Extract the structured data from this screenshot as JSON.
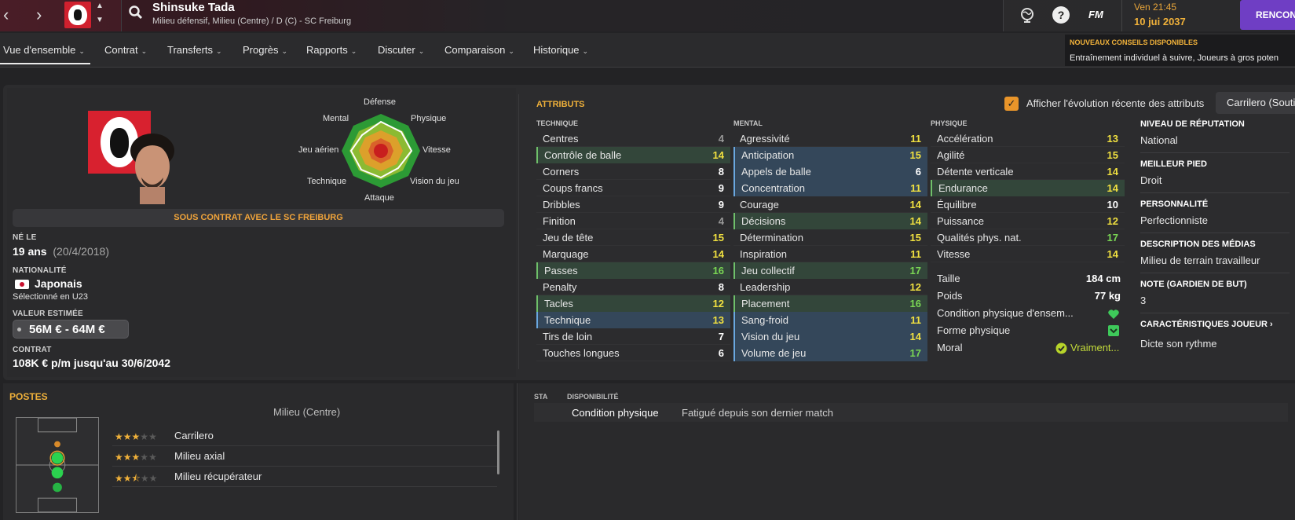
{
  "header": {
    "player_name": "Shinsuke Tada",
    "player_sub": "Milieu défensif, Milieu (Centre) / D (C) - SC Freiburg",
    "time": "Ven 21:45",
    "date": "10 jui 2037",
    "continue": "RENCON",
    "fm": "FM",
    "help": "?"
  },
  "nav": {
    "tabs": [
      "Vue d'ensemble",
      "Contrat",
      "Transferts",
      "Progrès",
      "Rapports",
      "Discuter",
      "Comparaison",
      "Historique"
    ]
  },
  "advice": {
    "title": "NOUVEAUX CONSEILS DISPONIBLES",
    "text": "Entraînement individuel à suivre, Joueurs à gros poten"
  },
  "radar": {
    "labels": [
      "Défense",
      "Physique",
      "Vitesse",
      "Vision du jeu",
      "Attaque",
      "Technique",
      "Jeu aérien",
      "Mental"
    ]
  },
  "profile": {
    "contract_banner": "SOUS CONTRAT AVEC LE SC FREIBURG",
    "born_label": "NÉ LE",
    "age": "19 ans",
    "birth": "(20/4/2018)",
    "nat_label": "NATIONALITÉ",
    "nationality": "Japonais",
    "selection": "Sélectionné en U23",
    "value_label": "VALEUR ESTIMÉE",
    "value": "56M € - 64M €",
    "contract_label": "CONTRAT",
    "contract": "108K € p/m jusqu'au 30/6/2042"
  },
  "attributes": {
    "title": "ATTRIBUTS",
    "evolution_label": "Afficher l'évolution récente des attributs",
    "role": "Carrilero (Soutien)",
    "technique_header": "TECHNIQUE",
    "mental_header": "MENTAL",
    "physique_header": "PHYSIQUE",
    "technique": [
      {
        "name": "Centres",
        "value": "4",
        "style": "plain",
        "color": "#9a9a9a"
      },
      {
        "name": "Contrôle de balle",
        "value": "14",
        "style": "green",
        "color": "#f0e040"
      },
      {
        "name": "Corners",
        "value": "8",
        "style": "plain",
        "color": "#ffffff"
      },
      {
        "name": "Coups francs",
        "value": "9",
        "style": "plain",
        "color": "#ffffff"
      },
      {
        "name": "Dribbles",
        "value": "9",
        "style": "plain",
        "color": "#ffffff"
      },
      {
        "name": "Finition",
        "value": "4",
        "style": "plain",
        "color": "#9a9a9a"
      },
      {
        "name": "Jeu de tête",
        "value": "15",
        "style": "plain",
        "color": "#f0e040"
      },
      {
        "name": "Marquage",
        "value": "14",
        "style": "plain",
        "color": "#f0e040"
      },
      {
        "name": "Passes",
        "value": "16",
        "style": "green",
        "color": "#7ad654"
      },
      {
        "name": "Penalty",
        "value": "8",
        "style": "plain",
        "color": "#ffffff"
      },
      {
        "name": "Tacles",
        "value": "12",
        "style": "green",
        "color": "#f0e040"
      },
      {
        "name": "Technique",
        "value": "13",
        "style": "blue",
        "color": "#f0e040"
      },
      {
        "name": "Tirs de loin",
        "value": "7",
        "style": "plain",
        "color": "#ffffff"
      },
      {
        "name": "Touches longues",
        "value": "6",
        "style": "plain",
        "color": "#ffffff"
      }
    ],
    "mental": [
      {
        "name": "Agressivité",
        "value": "11",
        "style": "plain",
        "color": "#f0e040"
      },
      {
        "name": "Anticipation",
        "value": "15",
        "style": "blue",
        "color": "#f0e040"
      },
      {
        "name": "Appels de balle",
        "value": "6",
        "style": "blue",
        "color": "#ffffff"
      },
      {
        "name": "Concentration",
        "value": "11",
        "style": "blue",
        "color": "#f0e040"
      },
      {
        "name": "Courage",
        "value": "14",
        "style": "plain",
        "color": "#f0e040"
      },
      {
        "name": "Décisions",
        "value": "14",
        "style": "green",
        "color": "#f0e040"
      },
      {
        "name": "Détermination",
        "value": "15",
        "style": "plain",
        "color": "#f0e040"
      },
      {
        "name": "Inspiration",
        "value": "11",
        "style": "plain",
        "color": "#f0e040"
      },
      {
        "name": "Jeu collectif",
        "value": "17",
        "style": "green",
        "color": "#7ad654"
      },
      {
        "name": "Leadership",
        "value": "12",
        "style": "plain",
        "color": "#f0e040"
      },
      {
        "name": "Placement",
        "value": "16",
        "style": "green",
        "color": "#7ad654"
      },
      {
        "name": "Sang-froid",
        "value": "11",
        "style": "blue",
        "color": "#f0e040"
      },
      {
        "name": "Vision du jeu",
        "value": "14",
        "style": "blue",
        "color": "#f0e040"
      },
      {
        "name": "Volume de jeu",
        "value": "17",
        "style": "blue",
        "color": "#7ad654"
      }
    ],
    "physique": [
      {
        "name": "Accélération",
        "value": "13",
        "style": "plain",
        "color": "#f0e040"
      },
      {
        "name": "Agilité",
        "value": "15",
        "style": "plain",
        "color": "#f0e040"
      },
      {
        "name": "Détente verticale",
        "value": "14",
        "style": "plain",
        "color": "#f0e040"
      },
      {
        "name": "Endurance",
        "value": "14",
        "style": "green",
        "color": "#f0e040"
      },
      {
        "name": "Équilibre",
        "value": "10",
        "style": "plain",
        "color": "#ffffff"
      },
      {
        "name": "Puissance",
        "value": "12",
        "style": "plain",
        "color": "#f0e040"
      },
      {
        "name": "Qualités phys. nat.",
        "value": "17",
        "style": "plain",
        "color": "#7ad654"
      },
      {
        "name": "Vitesse",
        "value": "14",
        "style": "plain",
        "color": "#f0e040"
      }
    ],
    "height_label": "Taille",
    "height": "184 cm",
    "weight_label": "Poids",
    "weight": "77 kg",
    "cond_label": "Condition physique d'ensem...",
    "form_label": "Forme physique",
    "morale_label": "Moral",
    "morale": "Vraiment..."
  },
  "info": {
    "rep_label": "NIVEAU DE RÉPUTATION",
    "rep": "National",
    "foot_label": "MEILLEUR PIED",
    "foot": "Droit",
    "perso_label": "PERSONNALITÉ",
    "perso": "Perfectionniste",
    "media_label": "DESCRIPTION DES MÉDIAS",
    "media": "Milieu de terrain travailleur",
    "gk_label": "NOTE (GARDIEN DE BUT)",
    "gk": "3",
    "traits_label": "CARACTÉRISTIQUES JOUEUR",
    "traits": "Dicte son rythme"
  },
  "positions": {
    "title": "POSTES",
    "center": "Milieu (Centre)",
    "roles": [
      {
        "name": "Carrilero",
        "stars": 3,
        "half": false
      },
      {
        "name": "Milieu axial",
        "stars": 3,
        "half": false
      },
      {
        "name": "Milieu récupérateur",
        "stars": 2,
        "half": true
      }
    ]
  },
  "availability": {
    "sta": "STA",
    "dispo": "DISPONIBILITÉ",
    "cond_label": "Condition physique",
    "cond_value": "Fatigué depuis son dernier match"
  }
}
